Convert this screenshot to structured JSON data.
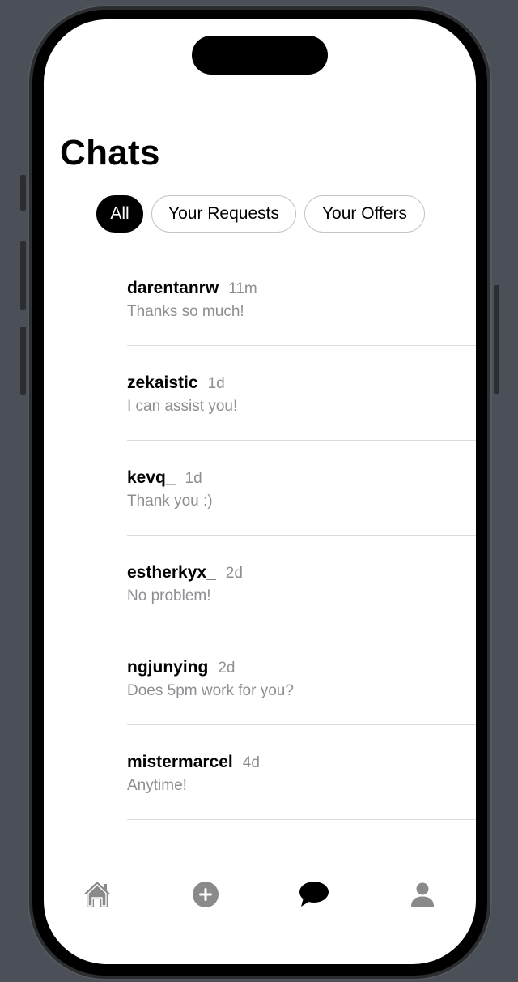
{
  "header": {
    "title": "Chats"
  },
  "filters": [
    {
      "label": "All",
      "active": true
    },
    {
      "label": "Your Requests",
      "active": false
    },
    {
      "label": "Your Offers",
      "active": false
    }
  ],
  "chats": [
    {
      "name": "darentanrw",
      "time": "11m",
      "message": "Thanks so much!"
    },
    {
      "name": "zekaistic",
      "time": "1d",
      "message": "I can assist you!"
    },
    {
      "name": "kevq_",
      "time": "1d",
      "message": "Thank you :)"
    },
    {
      "name": "estherkyx_",
      "time": "2d",
      "message": "No problem!"
    },
    {
      "name": "ngjunying",
      "time": "2d",
      "message": "Does 5pm work for you?"
    },
    {
      "name": "mistermarcel",
      "time": "4d",
      "message": "Anytime!"
    }
  ],
  "tabbar": {
    "items": [
      {
        "icon": "home-icon",
        "active": false
      },
      {
        "icon": "add-circle-icon",
        "active": false
      },
      {
        "icon": "chat-bubble-icon",
        "active": true
      },
      {
        "icon": "person-icon",
        "active": false
      }
    ]
  },
  "colors": {
    "background": "#4b5058",
    "screen": "#ffffff",
    "active_chip": "#000000",
    "secondary_text": "#8e8e93",
    "inactive_icon": "#8a8a8a"
  }
}
